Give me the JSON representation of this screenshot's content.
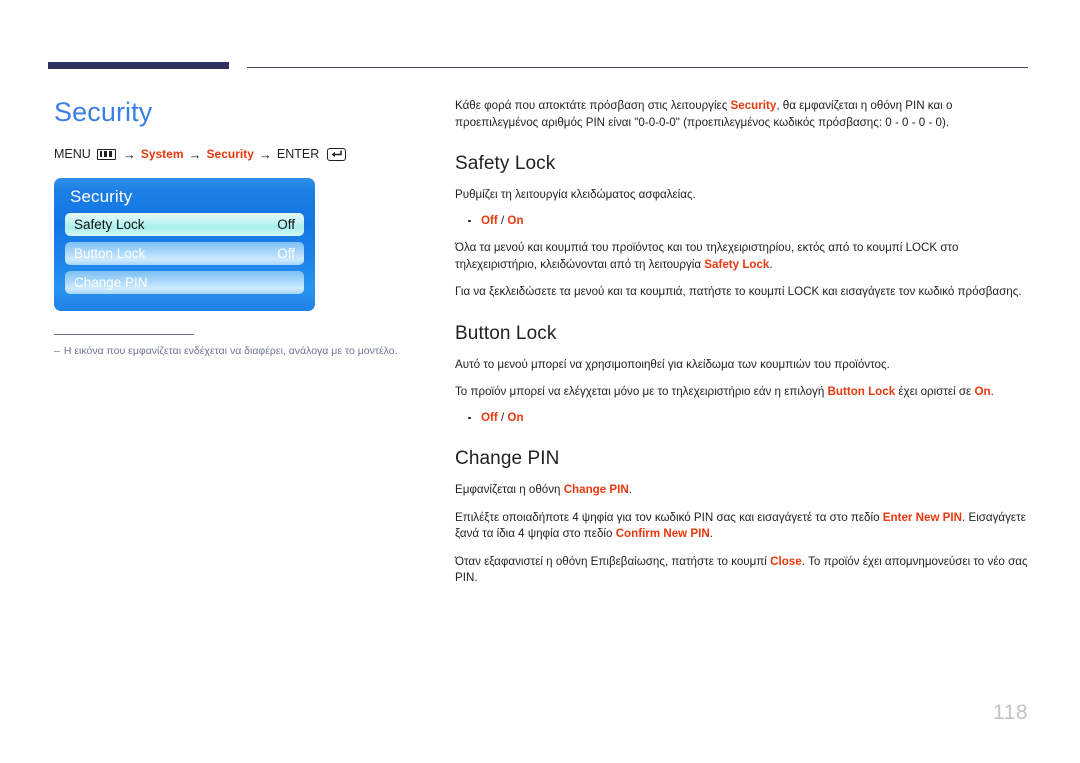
{
  "header": {
    "rule_color_thick": "#2e3060",
    "rule_color_thin": "#4b4e73"
  },
  "left": {
    "title": "Security",
    "title_color": "#3a7ee8",
    "breadcrumb": {
      "menu_label": "MENU",
      "menu_icon": "menu-bars-icon",
      "arrow": "→",
      "step_system": "System",
      "step_security": "Security",
      "enter_label": "ENTER",
      "enter_icon": "enter-return-icon"
    },
    "osd": {
      "title": "Security",
      "rows": [
        {
          "label": "Safety Lock",
          "value": "Off",
          "selected": true
        },
        {
          "label": "Button Lock",
          "value": "Off",
          "selected": false
        },
        {
          "label": "Change PIN",
          "value": "",
          "selected": false
        }
      ]
    },
    "footnote": {
      "dash": "–",
      "text": "Η εικόνα που εμφανίζεται ενδέχεται να διαφέρει, ανάλογα με το μοντέλο."
    }
  },
  "right": {
    "intro": {
      "p1_a": "Κάθε φορά που αποκτάτε πρόσβαση στις λειτουργίες ",
      "p1_hl": "Security",
      "p1_b": ", θα εμφανίζεται η οθόνη PIN και ο προεπιλεγμένος αριθμός PIN είναι \"0-0-0-0\" (προεπιλεγμένος κωδικός πρόσβασης: 0 - 0 - 0 - 0)."
    },
    "safety_lock": {
      "heading": "Safety Lock",
      "p1": "Ρυθμίζει τη λειτουργία κλειδώματος ασφαλείας.",
      "option_off": "Off",
      "option_sep": " / ",
      "option_on": "On",
      "p2_a": "Όλα τα μενού και κουμπιά του προϊόντος και του τηλεχειριστηρίου, εκτός από το κουμπί LOCK στο τηλεχειριστήριο, κλειδώνονται από τη λειτουργία ",
      "p2_hl": "Safety Lock",
      "p2_b": ".",
      "p3": "Για να ξεκλειδώσετε τα μενού και τα κουμπιά, πατήστε το κουμπί LOCK και εισαγάγετε τον κωδικό πρόσβασης."
    },
    "button_lock": {
      "heading": "Button Lock",
      "p1": "Αυτό το μενού μπορεί να χρησιμοποιηθεί για κλείδωμα των κουμπιών του προϊόντος.",
      "p2_a": "Το προϊόν μπορεί να ελέγχεται μόνο με το τηλεχειριστήριο εάν η επιλογή ",
      "p2_hl1": "Button Lock",
      "p2_b": " έχει οριστεί σε ",
      "p2_hl2": "On",
      "p2_c": ".",
      "option_off": "Off",
      "option_sep": " / ",
      "option_on": "On"
    },
    "change_pin": {
      "heading": "Change PIN",
      "p1_a": "Εμφανίζεται η οθόνη ",
      "p1_hl": "Change PIN",
      "p1_b": ".",
      "p2_a": "Επιλέξτε οποιαδήποτε 4 ψηφία για τον κωδικό PIN σας και εισαγάγετέ τα στο πεδίο ",
      "p2_hl1": "Enter New PIN",
      "p2_b": ". Εισαγάγετε ξανά τα ίδια 4 ψηφία στο πεδίο ",
      "p2_hl2": "Confirm New PIN",
      "p2_c": ".",
      "p3_a": "Όταν εξαφανιστεί η οθόνη Επιβεβαίωσης, πατήστε το κουμπί ",
      "p3_hl": "Close",
      "p3_b": ". Το προϊόν έχει απομνημονεύσει το νέο σας PIN."
    }
  },
  "footer": {
    "page_number": "118"
  },
  "colors": {
    "accent_red": "#e8380d",
    "title_blue": "#3a7ee8",
    "rule_navy": "#2e3060",
    "page_number_gray": "#c3c3c3"
  }
}
